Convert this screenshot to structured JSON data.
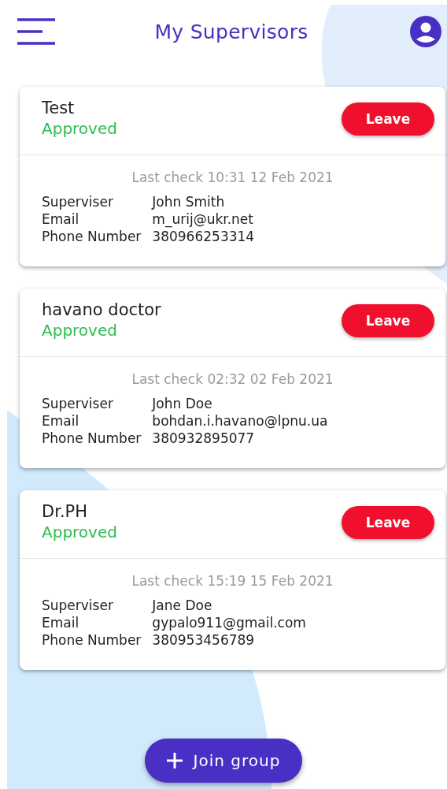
{
  "header": {
    "title": "My Supervisors"
  },
  "groups": [
    {
      "name": "Test",
      "status": "Approved",
      "action": "Leave",
      "last_check": "Last check 10:31 12 Feb 2021",
      "fields": [
        {
          "label": "Superviser",
          "value": "John Smith"
        },
        {
          "label": "Email",
          "value": "m_urij@ukr.net"
        },
        {
          "label": "Phone Number",
          "value": "380966253314"
        }
      ]
    },
    {
      "name": "havano doctor",
      "status": "Approved",
      "action": "Leave",
      "last_check": "Last check 02:32 02 Feb 2021",
      "fields": [
        {
          "label": "Superviser",
          "value": "John Doe"
        },
        {
          "label": "Email",
          "value": "bohdan.i.havano@lpnu.ua"
        },
        {
          "label": "Phone Number",
          "value": "380932895077"
        }
      ]
    },
    {
      "name": "Dr.PH",
      "status": "Approved",
      "action": "Leave",
      "last_check": "Last check 15:19 15 Feb 2021",
      "fields": [
        {
          "label": "Superviser",
          "value": "Jane Doe"
        },
        {
          "label": "Email",
          "value": "gypalo911@gmail.com"
        },
        {
          "label": "Phone Number",
          "value": "380953456789"
        }
      ]
    }
  ],
  "join_button": {
    "label": "Join group"
  }
}
